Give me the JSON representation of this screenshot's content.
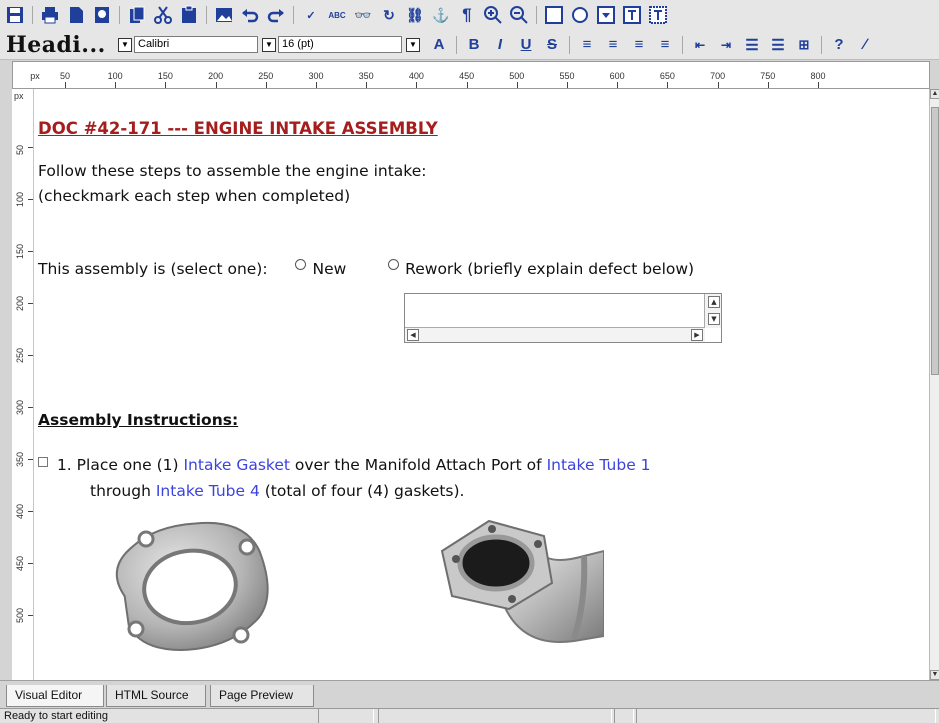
{
  "toolbar": {
    "style_name": "Headi...",
    "font_name": "Calibri",
    "font_size": "16 (pt)"
  },
  "ruler": {
    "unit": "px",
    "top_labels": [
      "50",
      "100",
      "150",
      "200",
      "250",
      "300",
      "350",
      "400",
      "450",
      "500",
      "550",
      "600",
      "650",
      "700",
      "750",
      "800"
    ],
    "left_labels": [
      "50",
      "100",
      "150",
      "200",
      "250",
      "300",
      "350",
      "400",
      "450",
      "500"
    ]
  },
  "document": {
    "title": "DOC #42-171 --- ENGINE INTAKE ASSEMBLY",
    "intro_line1": "Follow these steps to assemble the engine intake:",
    "intro_line2": "(checkmark each step when completed)",
    "select_prompt": "This assembly is (select one):",
    "option_new": "New",
    "option_rework": "Rework (briefly explain defect below)",
    "instructions_heading": "Assembly Instructions:",
    "step1": {
      "number": "1.",
      "text_a": "Place one (1)",
      "link_a": "Intake Gasket",
      "text_b": "over the Manifold Attach Port of",
      "link_b": "Intake Tube 1",
      "text_c": "through",
      "link_c": "Intake Tube 4",
      "text_d": "(total of four (4) gaskets)."
    }
  },
  "tabs": [
    "Visual Editor",
    "HTML Source",
    "Page Preview"
  ],
  "status_text": "Ready to start editing",
  "colors": {
    "title": "#a51d1d",
    "link": "#3c43e0",
    "toolbar_icon": "#1f3f9b"
  }
}
